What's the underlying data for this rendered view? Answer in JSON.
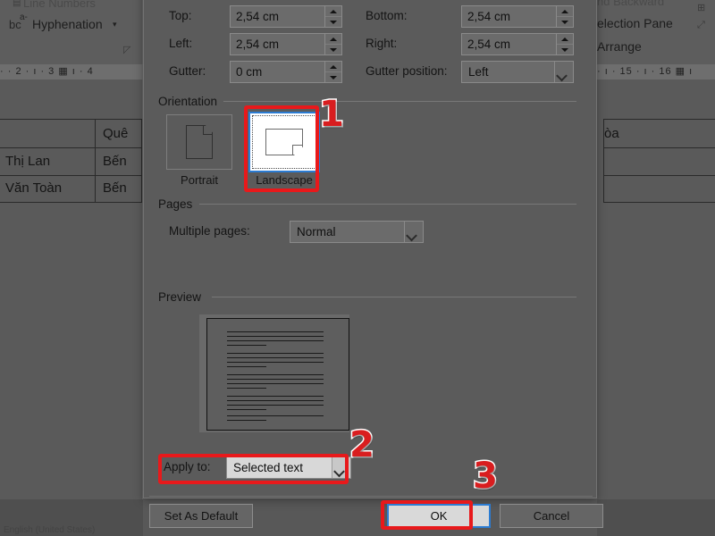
{
  "app": {
    "ribbon_left_items": [
      "Line Numbers",
      "Hyphenation"
    ],
    "ribbon_right_items": [
      "nd Backward",
      "election Pane",
      "Arrange"
    ],
    "ruler_left": "·  ·  2  ·   ı   ·  3  ▦  ı  ·  4",
    "ruler_right": "·   ı   ·  15  ·   ı   ·  16 ▦  ı",
    "dialog_launcher_icon": "dialog-launcher",
    "status_text": "English (United States)",
    "table_cells": {
      "header_right": "Quê",
      "row1_name": "Thị Lan",
      "row1_value": "Bến",
      "row2_name": "Văn Toàn",
      "row2_value": "Bến",
      "right_fragment": "òa"
    }
  },
  "dialog": {
    "margins": {
      "top": {
        "label": "Top:",
        "label_accel": "T",
        "value": "2,54 cm"
      },
      "bottom": {
        "label": "Bottom:",
        "label_accel": "B",
        "value": "2,54 cm"
      },
      "left": {
        "label": "Left:",
        "label_accel": "L",
        "value": "2,54 cm"
      },
      "right": {
        "label": "Right:",
        "label_accel": "R",
        "value": "2,54 cm"
      },
      "gutter": {
        "label": "Gutter:",
        "label_accel": "G",
        "value": "0 cm"
      },
      "gutter_position": {
        "label": "Gutter position:",
        "label_accel": "u",
        "value": "Left"
      }
    },
    "orientation": {
      "group_label": "Orientation",
      "portrait": {
        "label": "Portrait",
        "accel": "P",
        "selected": false,
        "icon": "portrait-page-icon"
      },
      "landscape": {
        "label": "Landscape",
        "accel": "s",
        "selected": true,
        "icon": "landscape-page-icon"
      }
    },
    "pages": {
      "group_label": "Pages",
      "multiple_pages": {
        "label": "Multiple pages:",
        "label_accel": "M",
        "value": "Normal"
      }
    },
    "preview": {
      "group_label": "Preview"
    },
    "apply_to": {
      "label": "Apply to:",
      "label_accel": "y",
      "value": "Selected text"
    },
    "buttons": {
      "set_as_default": {
        "label": "Set As Default",
        "accel": "D"
      },
      "ok": {
        "label": "OK",
        "is_default": true
      },
      "cancel": {
        "label": "Cancel"
      }
    }
  },
  "annotations": {
    "accent_color": "#e8191b",
    "badges": [
      {
        "number": "1",
        "target": "landscape-orientation"
      },
      {
        "number": "2",
        "target": "apply-to-row"
      },
      {
        "number": "3",
        "target": "ok-button"
      }
    ]
  }
}
